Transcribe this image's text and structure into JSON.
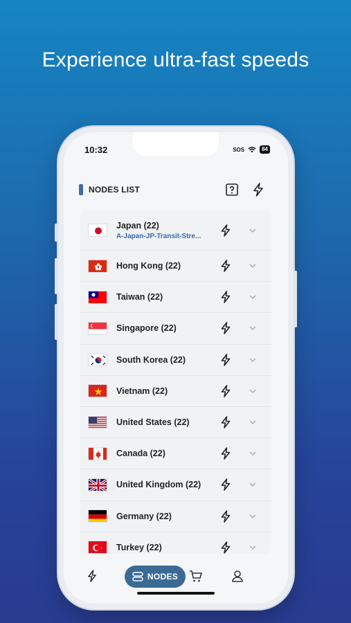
{
  "headline": "Experience ultra-fast speeds",
  "status": {
    "time": "10:32",
    "sos": "SOS",
    "battery": "84"
  },
  "header": {
    "title": "NODES LIST",
    "help_icon": "help-box-icon",
    "speed_icon": "lightning-icon"
  },
  "nodes": [
    {
      "country": "Japan (22)",
      "sub": "A-Japan-JP-Transit-Stre...",
      "flag": "japan"
    },
    {
      "country": "Hong Kong (22)",
      "flag": "hong-kong"
    },
    {
      "country": "Taiwan (22)",
      "flag": "taiwan"
    },
    {
      "country": "Singapore (22)",
      "flag": "singapore"
    },
    {
      "country": "South Korea (22)",
      "flag": "south-korea"
    },
    {
      "country": "Vietnam (22)",
      "flag": "vietnam"
    },
    {
      "country": "United States (22)",
      "flag": "united-states"
    },
    {
      "country": "Canada (22)",
      "flag": "canada"
    },
    {
      "country": "United Kingdom (22)",
      "flag": "united-kingdom"
    },
    {
      "country": "Germany (22)",
      "flag": "germany"
    },
    {
      "country": "Turkey (22)",
      "flag": "turkey"
    }
  ],
  "tabbar": {
    "nodes_label": "NODES"
  },
  "colors": {
    "accent": "#3b6b95",
    "link": "#3a6aa8"
  }
}
